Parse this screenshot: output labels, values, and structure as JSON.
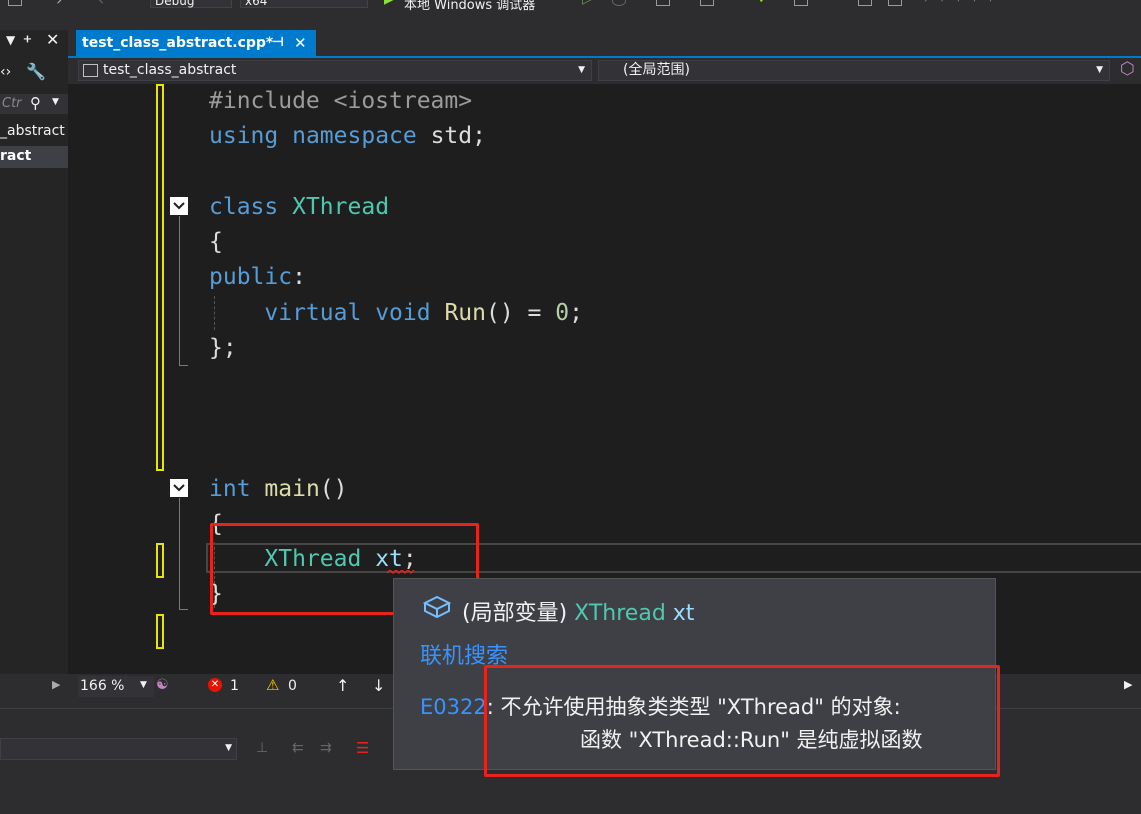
{
  "toolbar": {
    "config": "Debug",
    "platform": "x64",
    "debugger": "本地 Windows 调试器"
  },
  "left_panel": {
    "search_placeholder": "Ctr",
    "items": [
      "_abstract",
      "ract"
    ]
  },
  "tab": {
    "title": "test_class_abstract.cpp*",
    "pin_icon": "pin-icon",
    "close_icon": "close-icon"
  },
  "navbar": {
    "project": "test_class_abstract",
    "scope": "(全局范围)"
  },
  "code": {
    "lines": [
      "#include <iostream>",
      "using namespace std;",
      "class XThread",
      "{",
      "public:",
      "virtual void Run() = 0;",
      "};",
      "int main()",
      "{",
      "XThread xt;",
      "}"
    ]
  },
  "status": {
    "zoom": "166 %",
    "errors": "1",
    "warnings": "0"
  },
  "tooltip": {
    "kind": "(局部变量)",
    "type": "XThread",
    "name": "xt",
    "search_link": "联机搜索",
    "error_code": "E0322",
    "error_line1": ": 不允许使用抽象类类型 \"XThread\" 的对象:",
    "error_line2": "函数 \"XThread::Run\" 是纯虚拟函数"
  },
  "colors": {
    "accent": "#007acc",
    "highlight": "#e8231c",
    "change_marker": "#e6e600"
  }
}
